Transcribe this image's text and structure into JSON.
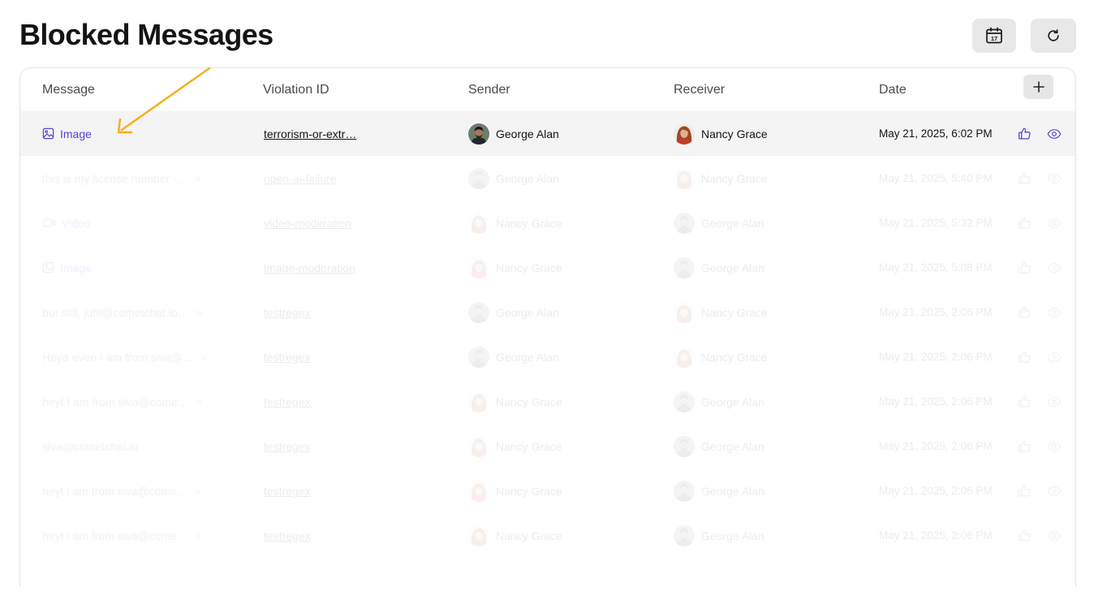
{
  "page": {
    "title": "Blocked Messages"
  },
  "toolbar": {
    "calendar_icon": "calendar-icon",
    "calendar_day": "17",
    "refresh_icon": "refresh-icon"
  },
  "table": {
    "columns": [
      "Message",
      "Violation ID",
      "Sender",
      "Receiver",
      "Date"
    ],
    "add_column_icon": "plus-icon",
    "rows": [
      {
        "message": "Image",
        "message_kind": "image",
        "violation": "terrorism-or-extr…",
        "sender": "George Alan",
        "sender_avatar": "male",
        "receiver": "Nancy Grace",
        "receiver_avatar": "female",
        "date": "May 21, 2025, 6:02 PM"
      },
      {
        "message": "this is my license number -…",
        "message_kind": "text-more",
        "violation": "open-ai-failure",
        "sender": "George Alan",
        "sender_avatar": "male",
        "receiver": "Nancy Grace",
        "receiver_avatar": "female",
        "date": "May 21, 2025, 5:40 PM"
      },
      {
        "message": "Video",
        "message_kind": "video",
        "violation": "video-moderation",
        "sender": "Nancy Grace",
        "sender_avatar": "female",
        "receiver": "George Alan",
        "receiver_avatar": "male",
        "date": "May 21, 2025, 5:32 PM"
      },
      {
        "message": "Image",
        "message_kind": "image",
        "violation": "image-moderation",
        "sender": "Nancy Grace",
        "sender_avatar": "female",
        "receiver": "George Alan",
        "receiver_avatar": "male",
        "date": "May 21, 2025, 5:08 PM"
      },
      {
        "message": "but still, juhi@cometchat.io…",
        "message_kind": "text-more",
        "violation": "testregex",
        "sender": "George Alan",
        "sender_avatar": "male",
        "receiver": "Nancy Grace",
        "receiver_avatar": "female",
        "date": "May 21, 2025, 2:06 PM"
      },
      {
        "message": "Heya even I am from siva@…",
        "message_kind": "text-more",
        "violation": "testregex",
        "sender": "George Alan",
        "sender_avatar": "male",
        "receiver": "Nancy Grace",
        "receiver_avatar": "female",
        "date": "May 21, 2025, 2:06 PM"
      },
      {
        "message": "heyt I am from siva@come…",
        "message_kind": "text-more",
        "violation": "testregex",
        "sender": "Nancy Grace",
        "sender_avatar": "female",
        "receiver": "George Alan",
        "receiver_avatar": "male",
        "date": "May 21, 2025, 2:06 PM"
      },
      {
        "message": "siva@cometchat.io",
        "message_kind": "text",
        "violation": "testregex",
        "sender": "Nancy Grace",
        "sender_avatar": "female",
        "receiver": "George Alan",
        "receiver_avatar": "male",
        "date": "May 21, 2025, 2:06 PM"
      },
      {
        "message": "heyt i am from siva@come…",
        "message_kind": "text-more",
        "violation": "testregex",
        "sender": "Nancy Grace",
        "sender_avatar": "female",
        "receiver": "George Alan",
        "receiver_avatar": "male",
        "date": "May 21, 2025, 2:06 PM"
      },
      {
        "message": "heyt i am from siva@come…",
        "message_kind": "text-more",
        "violation": "testregex",
        "sender": "Nancy Grace",
        "sender_avatar": "female",
        "receiver": "George Alan",
        "receiver_avatar": "male",
        "date": "May 21, 2025, 2:06 PM"
      }
    ],
    "row_actions": [
      "thumbs-up-icon",
      "eye-icon"
    ]
  },
  "colors": {
    "accent": "#5b3fd9",
    "annotation_arrow": "#f5b01a",
    "button_bg": "#e8e8e8"
  }
}
